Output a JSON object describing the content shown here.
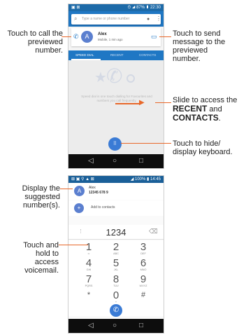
{
  "screen1": {
    "status_left": "▣ ⊠",
    "status_right": "⏱ ◢ 87% ▮ 22:30",
    "search_placeholder": "Type a name or phone number",
    "preview_initial": "A",
    "preview_name": "Alex",
    "preview_number": "Mobile, 1 min ago",
    "tabs": [
      "SPEED DIAL",
      "RECENT",
      "CONTACTS"
    ],
    "speed_dial_text": "Speed dial is one touch dialling for Favourites and numbers you call frequently."
  },
  "screen2": {
    "status_left": "⊠ ▣ ⚲ ▲ ⊠",
    "status_right": "◢ 100% ▮ 14:45",
    "suggestion_initial": "A",
    "suggestion_name": "Alex",
    "suggestion_number": "12345 678 9",
    "add_to_contacts": "Add to contacts",
    "dialed_number": "1234",
    "keys": [
      {
        "digit": "1",
        "letters": "∞"
      },
      {
        "digit": "2",
        "letters": "ABC"
      },
      {
        "digit": "3",
        "letters": "DEF"
      },
      {
        "digit": "4",
        "letters": "GHI"
      },
      {
        "digit": "5",
        "letters": "JKL"
      },
      {
        "digit": "6",
        "letters": "MNO"
      },
      {
        "digit": "7",
        "letters": "PQRS"
      },
      {
        "digit": "8",
        "letters": "TUV"
      },
      {
        "digit": "9",
        "letters": "WXYZ"
      },
      {
        "digit": "*",
        "letters": ""
      },
      {
        "digit": "0",
        "letters": "+"
      },
      {
        "digit": "#",
        "letters": ""
      }
    ]
  },
  "callouts": {
    "call_preview": "Touch to call the previewed number.",
    "send_message": "Touch to send message to the previewed number.",
    "slide_prefix": "Slide to access the",
    "slide_recent": "RECENT",
    "slide_and": "and",
    "slide_contacts": "CONTACTS",
    "slide_end": ".",
    "hide_keyboard": "Touch to hide/ display keyboard.",
    "suggested": "Display the suggested number(s).",
    "voicemail": "Touch and hold to access voicemail."
  },
  "colors": {
    "accent": "#1f77c4",
    "leader": "#e8682a",
    "avatar": "#5b7fcf",
    "fab": "#3a7bd5",
    "green": "#4caf50"
  },
  "icons": [
    "call-icon",
    "message-icon",
    "search-icon",
    "mic-icon",
    "more-icon",
    "star-icon",
    "phone-icon",
    "clock-icon",
    "dialpad-icon",
    "back-icon",
    "home-icon",
    "recents-icon",
    "add-contact-icon",
    "backspace-icon",
    "voicemail-icon"
  ]
}
